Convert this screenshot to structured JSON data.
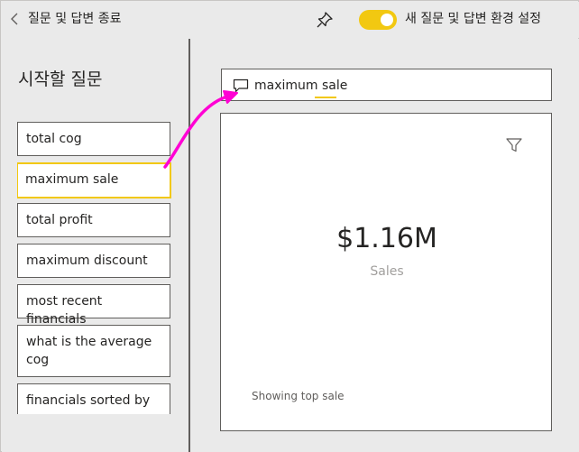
{
  "header": {
    "back_icon": "chevron-left-icon",
    "title": "질문 및 답변 종료",
    "pin_icon": "pin-icon",
    "toggle_on": true,
    "toggle_label": "새 질문 및 답변 환경 설정",
    "accent_color": "#f2c811"
  },
  "left_panel": {
    "title": "시작할 질문",
    "questions": [
      {
        "label": "total cog"
      },
      {
        "label": "maximum sale"
      },
      {
        "label": "total profit"
      },
      {
        "label": "maximum discount"
      },
      {
        "label": "most recent financials"
      },
      {
        "label": "what is the average cog"
      },
      {
        "label": "financials sorted by"
      }
    ]
  },
  "right_panel": {
    "search": {
      "icon": "chat-icon",
      "query": "maximum sale"
    },
    "card": {
      "filter_icon": "filter-icon",
      "value": "$1.16M",
      "label": "Sales",
      "footer": "Showing top sale"
    }
  },
  "annotation": {
    "arrow_color": "#ff00d4"
  }
}
